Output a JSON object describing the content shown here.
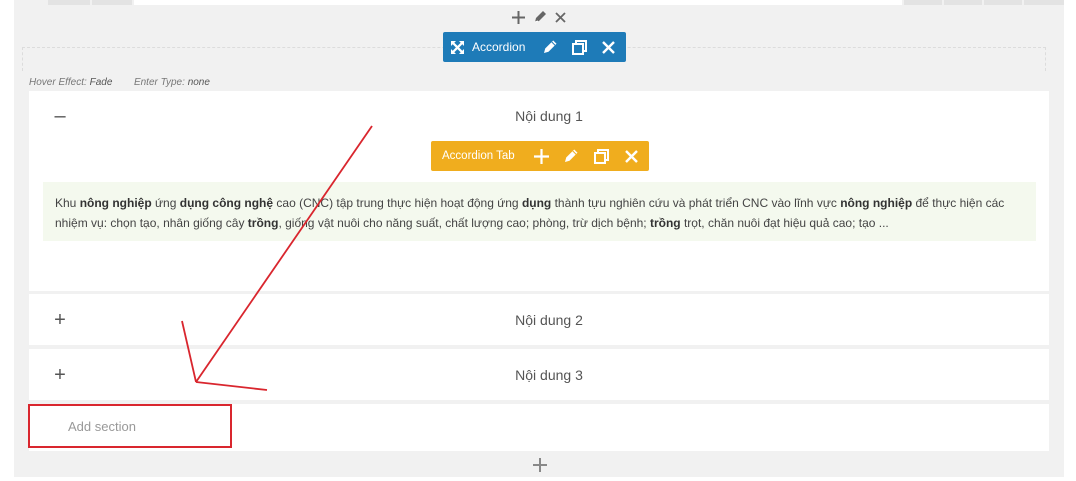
{
  "accordion_toolbar": {
    "label": "Accordion",
    "icons": [
      "move-icon",
      "pencil-icon",
      "duplicate-icon",
      "close-icon"
    ],
    "color": "#1e7bb8"
  },
  "row_controls": {
    "icons": [
      "plus-icon",
      "pencil-icon",
      "close-icon"
    ]
  },
  "meta": {
    "hover_label": "Hover Effect:",
    "hover_value": "Fade",
    "enter_label": "Enter Type:",
    "enter_value": "none"
  },
  "sections": [
    {
      "toggle": "–",
      "title": "Nội dung 1",
      "expanded": true
    },
    {
      "toggle": "+",
      "title": "Nội dung 2",
      "expanded": false
    },
    {
      "toggle": "+",
      "title": "Nội dung 3",
      "expanded": false
    }
  ],
  "tab_toolbar": {
    "label": "Accordion Tab",
    "icons": [
      "plus-icon",
      "pencil-icon",
      "duplicate-icon",
      "close-icon"
    ],
    "color": "#f0ad1e"
  },
  "content": {
    "segments": [
      [
        "Khu ",
        false
      ],
      [
        "nông nghiệp",
        true
      ],
      [
        " ứng ",
        false
      ],
      [
        "dụng công nghệ",
        true
      ],
      [
        " cao (CNC) tập trung thực hiện hoạt động ứng ",
        false
      ],
      [
        "dụng",
        true
      ],
      [
        " thành tựu nghiên cứu và phát triển CNC vào lĩnh vực ",
        false
      ],
      [
        "nông nghiệp",
        true
      ],
      [
        " để thực hiện các nhiệm vụ: chọn tạo, nhân giống cây ",
        false
      ],
      [
        "trồng",
        true
      ],
      [
        ", giống vật nuôi cho năng suất, chất lượng cao; phòng, trừ dịch bệnh; ",
        false
      ],
      [
        "trồng",
        true
      ],
      [
        " trọt, chăn nuôi đạt hiệu quả cao; tạo ...",
        false
      ]
    ]
  },
  "add_section": {
    "label": "Add section"
  },
  "annotation": {
    "color": "#d9262e"
  }
}
